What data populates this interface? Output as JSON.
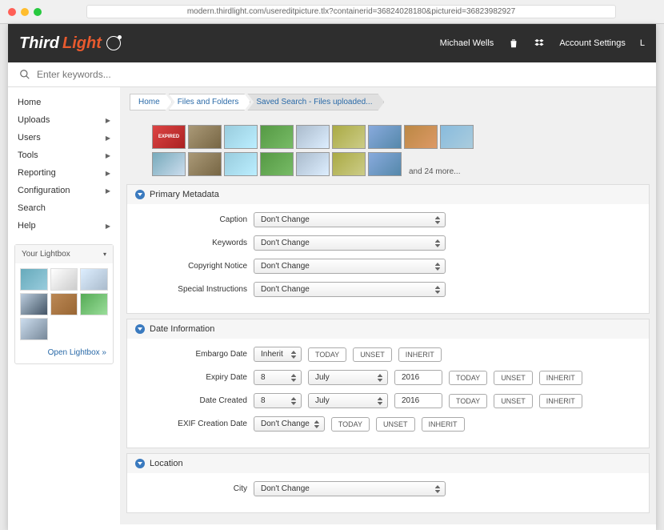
{
  "browser": {
    "url": "modern.thirdlight.com/usereditpicture.tlx?containerid=36824028180&pictureid=36823982927"
  },
  "brand": {
    "first": "Third",
    "second": "Light"
  },
  "header": {
    "user": "Michael Wells",
    "account": "Account Settings",
    "logout_initial": "L"
  },
  "search": {
    "placeholder": "Enter keywords..."
  },
  "nav": [
    {
      "label": "Home",
      "expandable": false
    },
    {
      "label": "Uploads",
      "expandable": true
    },
    {
      "label": "Users",
      "expandable": true
    },
    {
      "label": "Tools",
      "expandable": true
    },
    {
      "label": "Reporting",
      "expandable": true
    },
    {
      "label": "Configuration",
      "expandable": true
    },
    {
      "label": "Search",
      "expandable": false
    },
    {
      "label": "Help",
      "expandable": true
    }
  ],
  "lightbox": {
    "title": "Your Lightbox",
    "open_label": "Open Lightbox »"
  },
  "breadcrumbs": [
    "Home",
    "Files and Folders",
    "Saved Search - Files uploaded..."
  ],
  "thumbs": {
    "more": "and 24 more..."
  },
  "sections": {
    "primary": {
      "title": "Primary Metadata",
      "fields": {
        "caption": {
          "label": "Caption",
          "value": "Don't Change"
        },
        "keywords": {
          "label": "Keywords",
          "value": "Don't Change"
        },
        "copyright": {
          "label": "Copyright Notice",
          "value": "Don't Change"
        },
        "special": {
          "label": "Special Instructions",
          "value": "Don't Change"
        }
      }
    },
    "date": {
      "title": "Date Information",
      "buttons": {
        "today": "TODAY",
        "unset": "UNSET",
        "inherit": "INHERIT"
      },
      "fields": {
        "embargo": {
          "label": "Embargo Date",
          "value": "Inherit"
        },
        "expiry": {
          "label": "Expiry Date",
          "day": "8",
          "month": "July",
          "year": "2016"
        },
        "created": {
          "label": "Date Created",
          "day": "8",
          "month": "July",
          "year": "2016"
        },
        "exif": {
          "label": "EXIF Creation Date",
          "value": "Don't Change"
        }
      }
    },
    "location": {
      "title": "Location",
      "fields": {
        "city": {
          "label": "City",
          "value": "Don't Change"
        }
      }
    }
  }
}
